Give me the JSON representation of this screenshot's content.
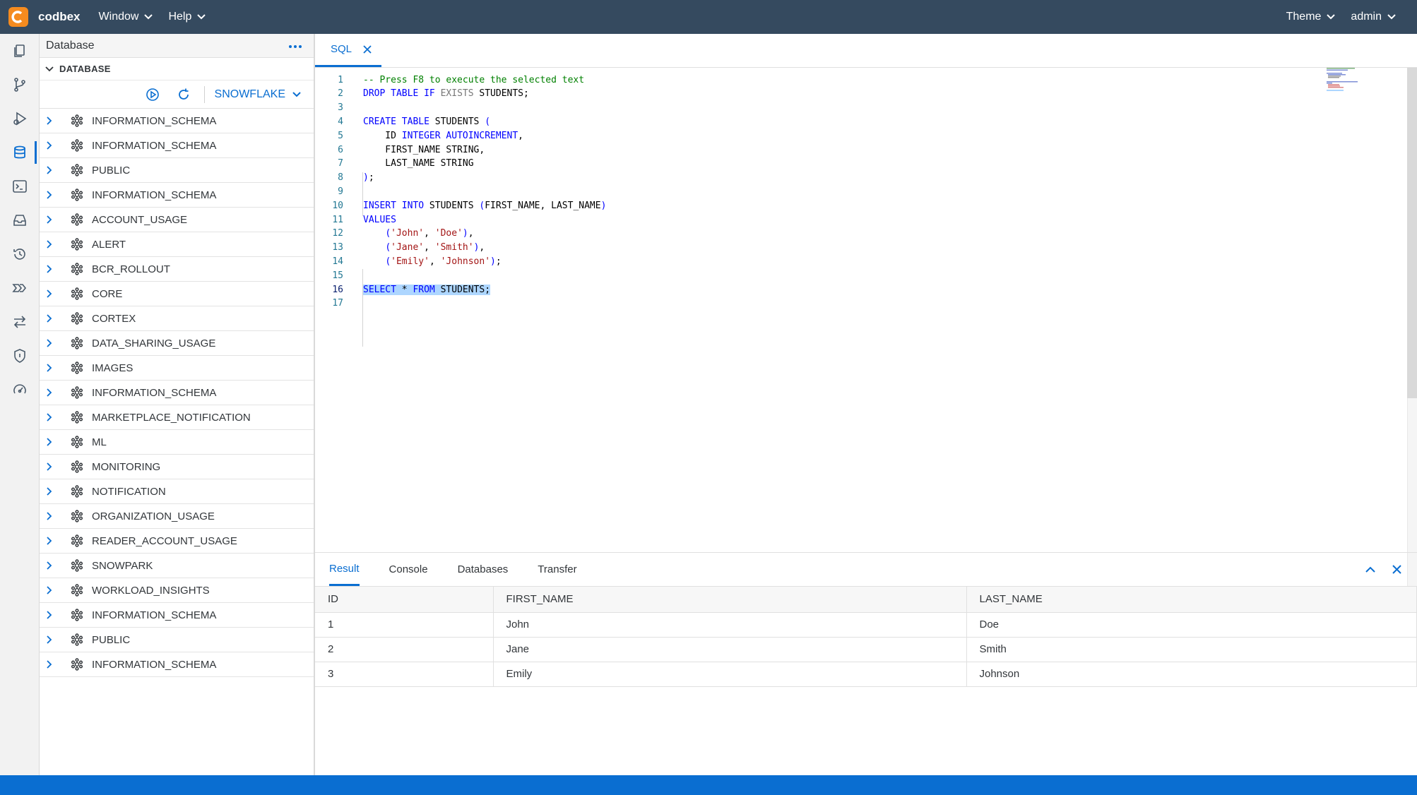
{
  "app": {
    "name": "codbex",
    "accent": "#0a6ed1",
    "logo_color": "#f58b1f"
  },
  "topbar": {
    "menus": [
      {
        "label": "Window"
      },
      {
        "label": "Help"
      }
    ],
    "theme_label": "Theme",
    "user_label": "admin"
  },
  "activity_bar": [
    {
      "icon": "documents-icon"
    },
    {
      "icon": "git-branch-icon"
    },
    {
      "icon": "run-debug-icon"
    },
    {
      "icon": "database-icon",
      "active": true
    },
    {
      "icon": "terminal-icon"
    },
    {
      "icon": "inbox-icon"
    },
    {
      "icon": "history-icon"
    },
    {
      "icon": "pipeline-icon"
    },
    {
      "icon": "transfer-icon"
    },
    {
      "icon": "shield-icon"
    },
    {
      "icon": "speedometer-icon"
    }
  ],
  "sidebar": {
    "title": "Database",
    "section": "DATABASE",
    "datasource": "SNOWFLAKE",
    "schemas": [
      "INFORMATION_SCHEMA",
      "INFORMATION_SCHEMA",
      "PUBLIC",
      "INFORMATION_SCHEMA",
      "ACCOUNT_USAGE",
      "ALERT",
      "BCR_ROLLOUT",
      "CORE",
      "CORTEX",
      "DATA_SHARING_USAGE",
      "IMAGES",
      "INFORMATION_SCHEMA",
      "MARKETPLACE_NOTIFICATION",
      "ML",
      "MONITORING",
      "NOTIFICATION",
      "ORGANIZATION_USAGE",
      "READER_ACCOUNT_USAGE",
      "SNOWPARK",
      "WORKLOAD_INSIGHTS",
      "INFORMATION_SCHEMA",
      "PUBLIC",
      "INFORMATION_SCHEMA"
    ]
  },
  "editor": {
    "tab_label": "SQL",
    "current_line": 16,
    "lines": [
      "-- Press F8 to execute the selected text",
      "DROP TABLE IF EXISTS STUDENTS;",
      "",
      "CREATE TABLE STUDENTS (",
      "    ID INTEGER AUTOINCREMENT,",
      "    FIRST_NAME STRING,",
      "    LAST_NAME STRING",
      ");",
      "",
      "INSERT INTO STUDENTS (FIRST_NAME, LAST_NAME)",
      "VALUES",
      "    ('John', 'Doe'),",
      "    ('Jane', 'Smith'),",
      "    ('Emily', 'Johnson');",
      "",
      "SELECT * FROM STUDENTS;",
      ""
    ]
  },
  "panel": {
    "tabs": [
      "Result",
      "Console",
      "Databases",
      "Transfer"
    ],
    "active_tab": "Result",
    "columns": [
      "ID",
      "FIRST_NAME",
      "LAST_NAME"
    ],
    "rows": [
      [
        "1",
        "John",
        "Doe"
      ],
      [
        "2",
        "Jane",
        "Smith"
      ],
      [
        "3",
        "Emily",
        "Johnson"
      ]
    ]
  }
}
